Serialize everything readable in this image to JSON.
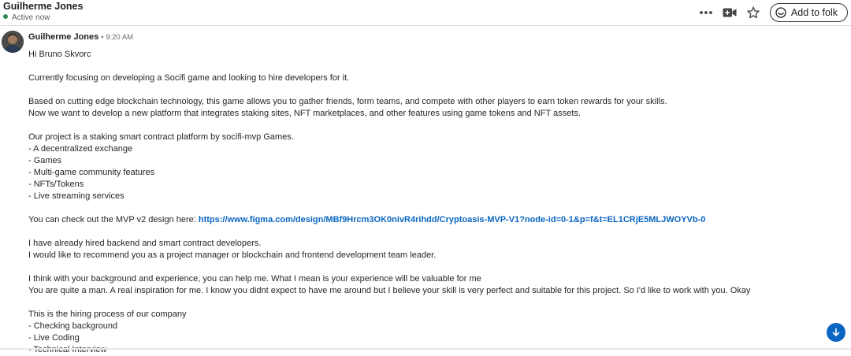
{
  "header": {
    "contact_name": "Guilherme Jones",
    "presence": "Active now",
    "add_button_label": "Add to folk"
  },
  "message": {
    "sender": "Guilherme Jones",
    "time": "• 9:20 AM",
    "greeting": "Hi Bruno Skvorc",
    "p1": "Currently focusing on developing a Socifi game and looking to hire developers for it.",
    "p2_l1": "Based on cutting edge blockchain technology, this game allows you to gather friends, form teams, and compete with other players to earn token rewards for your skills.",
    "p2_l2": "Now we want to develop a new platform that integrates staking sites, NFT marketplaces, and other features using game tokens and NFT assets.",
    "p3_intro": "Our project is a staking smart contract platform by socifi-mvp Games.",
    "features": [
      "- A decentralized exchange",
      "- Games",
      "- Multi-game community features",
      "- NFTs/Tokens",
      "- Live streaming services"
    ],
    "mvp_prefix": "You can check out the MVP v2 design here: ",
    "mvp_link": "https://www.figma.com/design/MBf9Hrcm3OK0nivR4rihdd/Cryptoasis-MVP-V1?node-id=0-1&p=f&t=EL1CRjE5MLJWOYVb-0",
    "p5_l1": "I have already hired backend and smart contract developers.",
    "p5_l2": "I would like to recommend you as a project manager or blockchain and frontend development team leader.",
    "p6_l1": "I think with your background and experience, you can help me. What I mean is your experience will be valuable for me",
    "p6_l2": "You are quite a man. A real inspiration for me. I know you didnt expect to have me around but I believe your skill is very perfect and suitable for this project. So I'd like to work with you. Okay",
    "p7_intro": "This is the hiring process of our company",
    "steps": [
      "- Checking background",
      "- Live Coding",
      "- Technical Interview"
    ]
  },
  "colors": {
    "link": "#0a66c2",
    "presence": "#2e8b57",
    "scroll_button": "#0a66c2"
  },
  "icons": [
    "more-icon",
    "video-icon",
    "star-icon",
    "folk-icon",
    "arrow-down-icon"
  ]
}
